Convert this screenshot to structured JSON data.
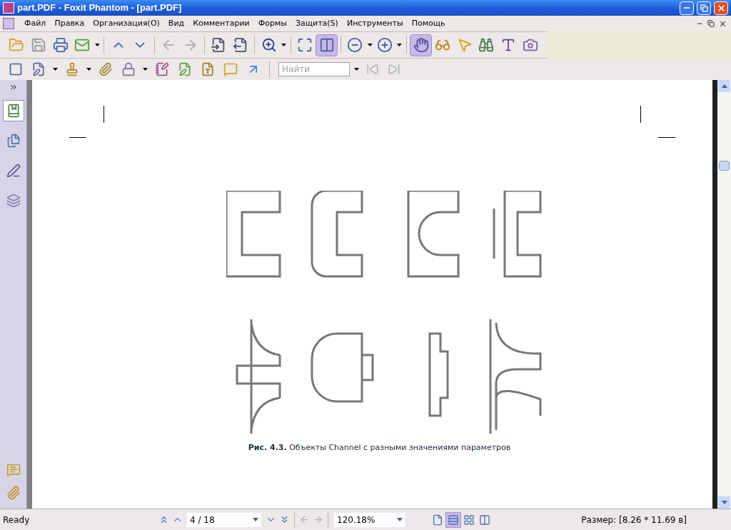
{
  "window": {
    "title": "part.PDF - Foxit Phantom - [part.PDF]"
  },
  "menu": [
    "Файл",
    "Правка",
    "Организация(O)",
    "Вид",
    "Комментарии",
    "Формы",
    "Защита(S)",
    "Инструменты",
    "Помощь"
  ],
  "toolbar_1": [
    {
      "selected": false
    },
    {
      "selected": false
    },
    {
      "selected": false
    },
    {
      "selected": false
    },
    {
      "selected": false
    },
    {
      "selected": false
    },
    {
      "selected": false
    },
    {
      "selected": false
    },
    {
      "selected": false
    },
    {
      "selected": false
    },
    {
      "selected": false
    },
    {
      "selected": false
    },
    {
      "selected": true
    },
    {
      "selected": false
    },
    {
      "selected": false
    },
    {
      "selected": true
    },
    {
      "selected": false
    },
    {
      "selected": false
    },
    {
      "selected": false
    },
    {
      "selected": false
    },
    {
      "selected": false
    }
  ],
  "search": {
    "placeholder": "Найти"
  },
  "sidebar": [
    {
      "selected": true
    },
    {
      "selected": false
    },
    {
      "selected": false
    },
    {
      "selected": false
    }
  ],
  "caption": "**Рис. 4.3.** Объекты Channel с разными значениями параметров",
  "status_bar": {
    "text": "Ready",
    "page": "4 / 18",
    "zoom": "120.18%",
    "view_modes": [
      {
        "selected": false
      },
      {
        "selected": true
      },
      {
        "selected": false
      },
      {
        "selected": false
      }
    ],
    "size": "Размер: [8.26 * 11.69 в]"
  }
}
